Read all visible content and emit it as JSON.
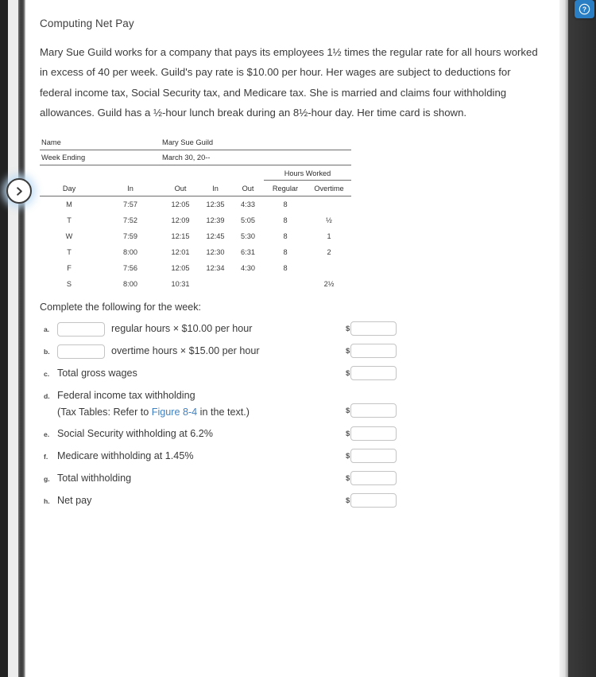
{
  "window": {
    "help_button_label": "?",
    "next_nav_label": ">"
  },
  "document": {
    "title": "Computing Net Pay",
    "intro": "Mary Sue Guild works for a company that pays its employees 1½ times the regular rate for all hours worked in excess of 40 per week. Guild's pay rate is $10.00 per hour. Her wages are subject to deductions for federal income tax, Social Security tax, and Medicare tax. She is married and claims four withholding allowances. Guild has a ½-hour lunch break during an 8½-hour day. Her time card is shown.",
    "complete_label": "Complete the following for the week:"
  },
  "timecard": {
    "name_label": "Name",
    "name_value": "Mary Sue Guild",
    "week_ending_label": "Week Ending",
    "week_ending_value": "March 30, 20--",
    "group_header": "Hours Worked",
    "columns": [
      "Day",
      "In",
      "Out",
      "In",
      "Out",
      "Regular",
      "Overtime"
    ],
    "rows": [
      {
        "day": "M",
        "in1": "7:57",
        "out1": "12:05",
        "in2": "12:35",
        "out2": "4:33",
        "regular": "8",
        "overtime": ""
      },
      {
        "day": "T",
        "in1": "7:52",
        "out1": "12:09",
        "in2": "12:39",
        "out2": "5:05",
        "regular": "8",
        "overtime": "½"
      },
      {
        "day": "W",
        "in1": "7:59",
        "out1": "12:15",
        "in2": "12:45",
        "out2": "5:30",
        "regular": "8",
        "overtime": "1"
      },
      {
        "day": "T",
        "in1": "8:00",
        "out1": "12:01",
        "in2": "12:30",
        "out2": "6:31",
        "regular": "8",
        "overtime": "2"
      },
      {
        "day": "F",
        "in1": "7:56",
        "out1": "12:05",
        "in2": "12:34",
        "out2": "4:30",
        "regular": "8",
        "overtime": ""
      },
      {
        "day": "S",
        "in1": "8:00",
        "out1": "10:31",
        "in2": "",
        "out2": "",
        "regular": "",
        "overtime": "2½"
      }
    ]
  },
  "questions": [
    {
      "letter": "a.",
      "has_left_input": true,
      "left_value": "",
      "text": "regular hours × $10.00 per hour",
      "sub": "",
      "dollar": "$",
      "answer_value": ""
    },
    {
      "letter": "b.",
      "has_left_input": true,
      "left_value": "",
      "text": "overtime hours × $15.00 per hour",
      "sub": "",
      "dollar": "$",
      "answer_value": ""
    },
    {
      "letter": "c.",
      "has_left_input": false,
      "left_value": "",
      "text": "Total gross wages",
      "sub": "",
      "dollar": "$",
      "answer_value": ""
    },
    {
      "letter": "d.",
      "has_left_input": false,
      "left_value": "",
      "text": "Federal income tax withholding",
      "sub_prefix": "(Tax Tables: Refer to ",
      "sub_link": "Figure 8-4",
      "sub_suffix": " in the text.)",
      "dollar": "$",
      "answer_value": ""
    },
    {
      "letter": "e.",
      "has_left_input": false,
      "left_value": "",
      "text": "Social Security withholding at 6.2%",
      "sub": "",
      "dollar": "$",
      "answer_value": ""
    },
    {
      "letter": "f.",
      "has_left_input": false,
      "left_value": "",
      "text": "Medicare withholding at 1.45%",
      "sub": "",
      "dollar": "$",
      "answer_value": ""
    },
    {
      "letter": "g.",
      "has_left_input": false,
      "left_value": "",
      "text": "Total withholding",
      "sub": "",
      "dollar": "$",
      "answer_value": ""
    },
    {
      "letter": "h.",
      "has_left_input": false,
      "left_value": "",
      "text": "Net pay",
      "sub": "",
      "dollar": "$",
      "answer_value": ""
    }
  ],
  "colors": {
    "link": "#4281be",
    "help_button": "#2a7fc4",
    "text": "#3a3a3a"
  }
}
